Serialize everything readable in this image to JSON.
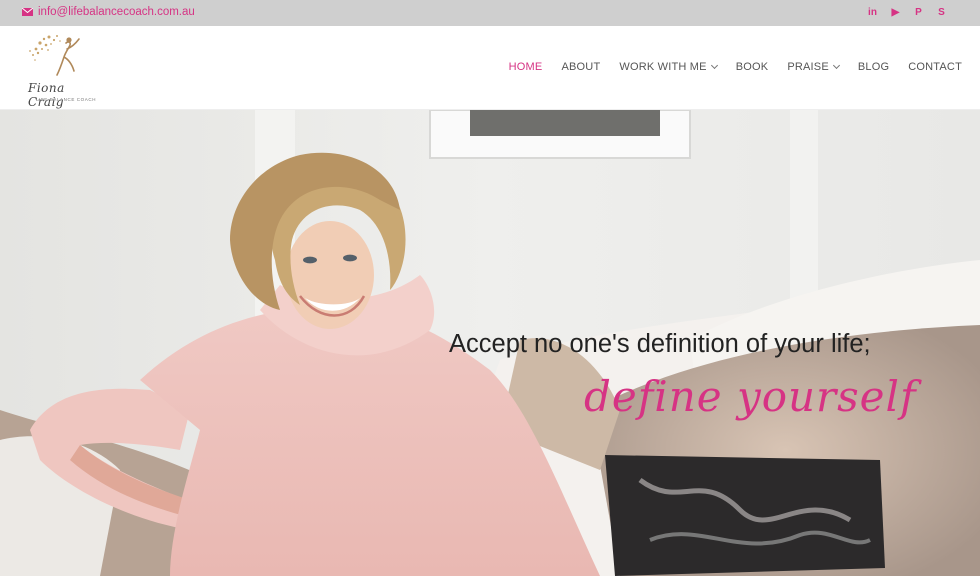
{
  "topbar": {
    "email": "info@lifebalancecoach.com.au",
    "social": [
      {
        "icon": "linkedin-icon",
        "glyph": "in"
      },
      {
        "icon": "youtube-icon",
        "glyph": "▶"
      },
      {
        "icon": "pinterest-icon",
        "glyph": "P"
      },
      {
        "icon": "skype-icon",
        "glyph": "S"
      }
    ]
  },
  "logo": {
    "name": "Fiona Craig",
    "tagline": "LIFE BALANCE COACH"
  },
  "nav": {
    "items": [
      {
        "label": "HOME",
        "active": true,
        "dropdown": false
      },
      {
        "label": "ABOUT",
        "active": false,
        "dropdown": false
      },
      {
        "label": "WORK WITH ME",
        "active": false,
        "dropdown": true
      },
      {
        "label": "BOOK",
        "active": false,
        "dropdown": false
      },
      {
        "label": "PRAISE",
        "active": false,
        "dropdown": true
      },
      {
        "label": "BLOG",
        "active": false,
        "dropdown": false
      },
      {
        "label": "CONTACT",
        "active": false,
        "dropdown": false
      }
    ]
  },
  "hero": {
    "line1": "Accept no one's definition of your life;",
    "line2": "define yourself"
  },
  "colors": {
    "accent": "#d63384",
    "topbar": "#cfcfcf"
  }
}
